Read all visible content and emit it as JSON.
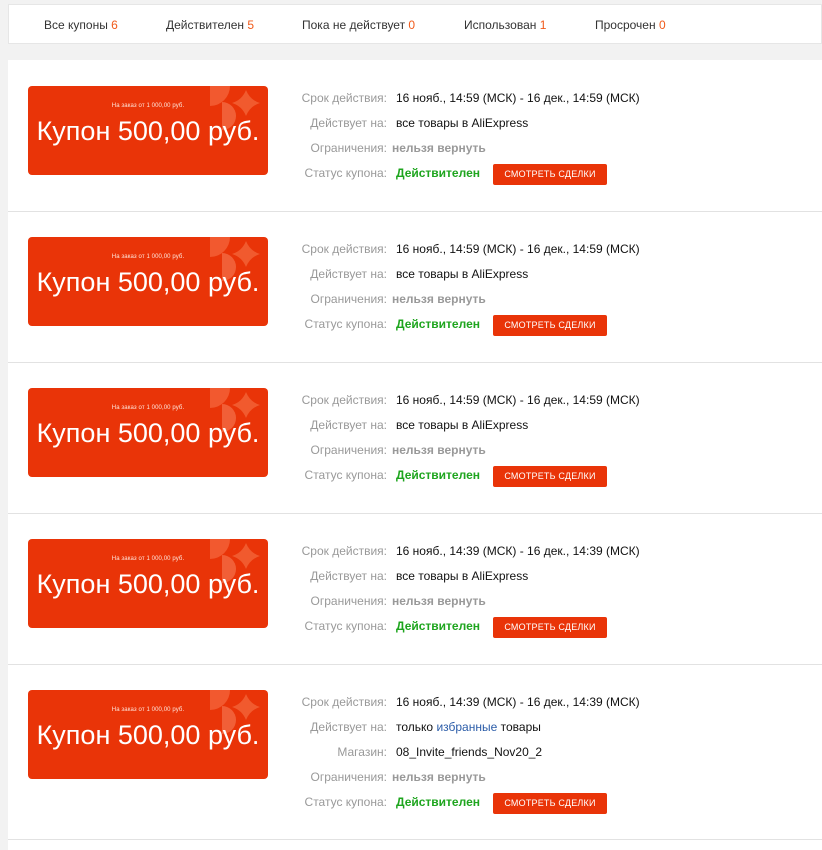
{
  "tabs": [
    {
      "label": "Все купоны",
      "count": "6"
    },
    {
      "label": "Действителен",
      "count": "5"
    },
    {
      "label": "Пока не действует",
      "count": "0"
    },
    {
      "label": "Использован",
      "count": "1"
    },
    {
      "label": "Просрочен",
      "count": "0"
    }
  ],
  "labels": {
    "validity": "Срок действия:",
    "applies": "Действует на:",
    "shop": "Магазин:",
    "limits": "Ограничения:",
    "status": "Статус купона:"
  },
  "button_label": "СМОТРЕТЬ СДЕЛКИ",
  "colors": {
    "accent": "#e93408",
    "status_ok": "#1ea51e",
    "count": "#f05a1a",
    "link": "#2b5ca8"
  },
  "coupons": [
    {
      "min_order": "На заказ от 1 000,00 руб.",
      "amount": "Купон 500,00 руб.",
      "validity": "16 нояб., 14:59 (МСК) - 16 дек., 14:59 (МСК)",
      "applies": "все товары в AliExpress",
      "limits": "нельзя вернуть",
      "status": "Действителен"
    },
    {
      "min_order": "На заказ от 1 000,00 руб.",
      "amount": "Купон 500,00 руб.",
      "validity": "16 нояб., 14:59 (МСК) - 16 дек., 14:59 (МСК)",
      "applies": "все товары в AliExpress",
      "limits": "нельзя вернуть",
      "status": "Действителен"
    },
    {
      "min_order": "На заказ от 1 000,00 руб.",
      "amount": "Купон 500,00 руб.",
      "validity": "16 нояб., 14:59 (МСК) - 16 дек., 14:59 (МСК)",
      "applies": "все товары в AliExpress",
      "limits": "нельзя вернуть",
      "status": "Действителен"
    },
    {
      "min_order": "На заказ от 1 000,00 руб.",
      "amount": "Купон 500,00 руб.",
      "validity": "16 нояб., 14:39 (МСК) - 16 дек., 14:39 (МСК)",
      "applies": "все товары в AliExpress",
      "limits": "нельзя вернуть",
      "status": "Действителен"
    },
    {
      "min_order": "На заказ от 1 000,00 руб.",
      "amount": "Купон 500,00 руб.",
      "validity": "16 нояб., 14:39 (МСК) - 16 дек., 14:39 (МСК)",
      "applies_prefix": "только",
      "applies_link": "избранные",
      "applies_suffix": "товары",
      "shop": "08_Invite_friends_Nov20_2",
      "limits": "нельзя вернуть",
      "status": "Действителен"
    }
  ]
}
